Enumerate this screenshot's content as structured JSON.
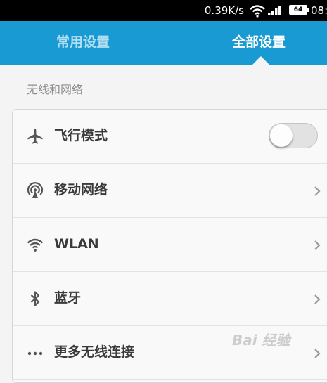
{
  "status_bar": {
    "speed": "0.39K/s",
    "battery": "64",
    "time": "08:"
  },
  "tabs": {
    "common": "常用设置",
    "all": "全部设置"
  },
  "section": {
    "title": "无线和网络"
  },
  "items": [
    {
      "label": "飞行模式",
      "icon": "airplane-icon",
      "control": "toggle",
      "toggle_on": false
    },
    {
      "label": "移动网络",
      "icon": "antenna-icon",
      "control": "chevron"
    },
    {
      "label": "WLAN",
      "icon": "wifi-icon",
      "control": "chevron"
    },
    {
      "label": "蓝牙",
      "icon": "bluetooth-icon",
      "control": "chevron"
    },
    {
      "label": "更多无线连接",
      "icon": "more-dots-icon",
      "control": "chevron"
    }
  ],
  "watermark": "Bai 经验",
  "colors": {
    "accent": "#1a9ad3",
    "status_bar": "#000000",
    "background": "#f4f4f4"
  }
}
